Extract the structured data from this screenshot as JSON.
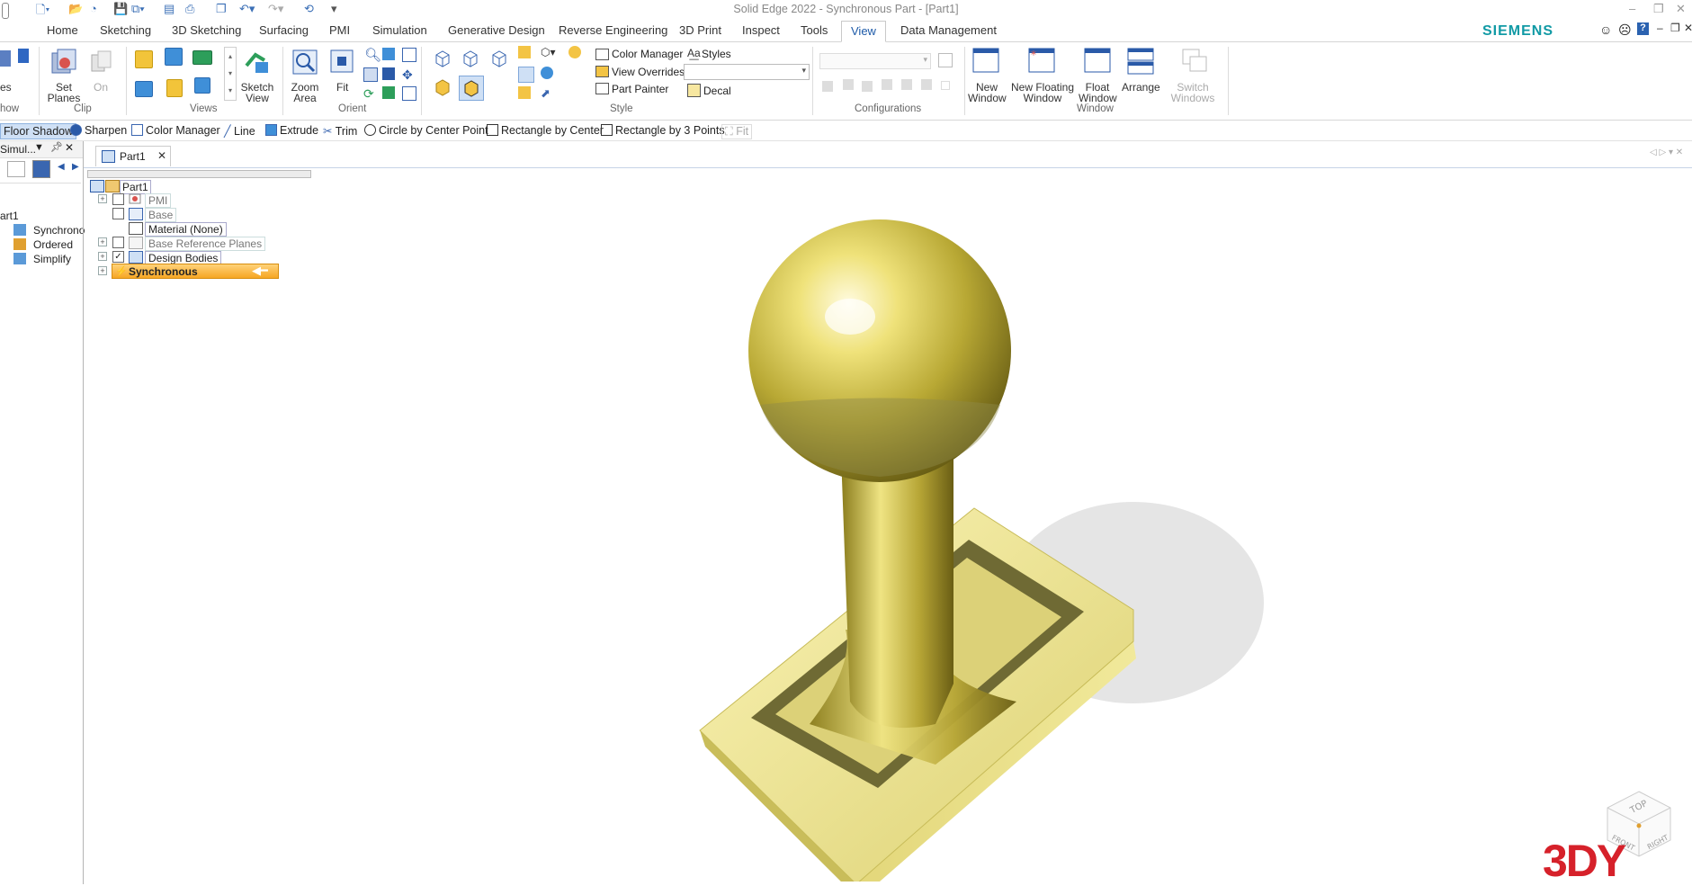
{
  "window": {
    "title": "Solid Edge 2022 - Synchronous Part - [Part1]",
    "brand": "SIEMENS",
    "brand_color": "#119aa5",
    "accent_color": "#1d5aa8"
  },
  "menu_tabs": [
    "Home",
    "Sketching",
    "3D Sketching",
    "Surfacing",
    "PMI",
    "Simulation",
    "Generative Design",
    "Reverse Engineering",
    "3D Print",
    "Inspect",
    "Tools",
    "View",
    "Data Management"
  ],
  "active_tab": "View",
  "ribbon": {
    "show_partial": "es",
    "show_group": "how",
    "set_planes": "Set Planes",
    "on": "On",
    "clip_group": "Clip",
    "sketch_view": "Sketch View",
    "views_group": "Views",
    "zoom_area": "Zoom Area",
    "fit": "Fit",
    "orient_group": "Orient",
    "color_manager": "Color Manager",
    "styles": "Styles",
    "view_overrides": "View Overrides",
    "part_painter": "Part Painter",
    "decal": "Decal",
    "style_group": "Style",
    "configurations_group": "Configurations",
    "new_window": "New Window",
    "new_floating_window": "New Floating Window",
    "float_window": "Float Window",
    "arrange": "Arrange",
    "window_group": "Window",
    "switch_windows": "Switch Windows"
  },
  "command_bar": [
    "Floor Shadow",
    "Sharpen",
    "Color Manager",
    "Line",
    "Extrude",
    "Trim",
    "Circle by Center Point",
    "Rectangle by Center",
    "Rectangle by 3 Points",
    "Fit"
  ],
  "left_panel": {
    "header": "Simul...",
    "root": "art1",
    "items": [
      "Synchrono",
      "Ordered",
      "Simplify"
    ]
  },
  "doc_tab": "Part1",
  "tree": {
    "root": "Part1",
    "nodes": [
      "PMI",
      "Base",
      "Material (None)",
      "Base Reference Planes",
      "Design Bodies",
      "Synchronous"
    ]
  },
  "view_cube": {
    "top": "TOP",
    "front": "FRONT",
    "right": "RIGHT"
  },
  "watermark": "3DY",
  "model_color": "#e6e08a"
}
